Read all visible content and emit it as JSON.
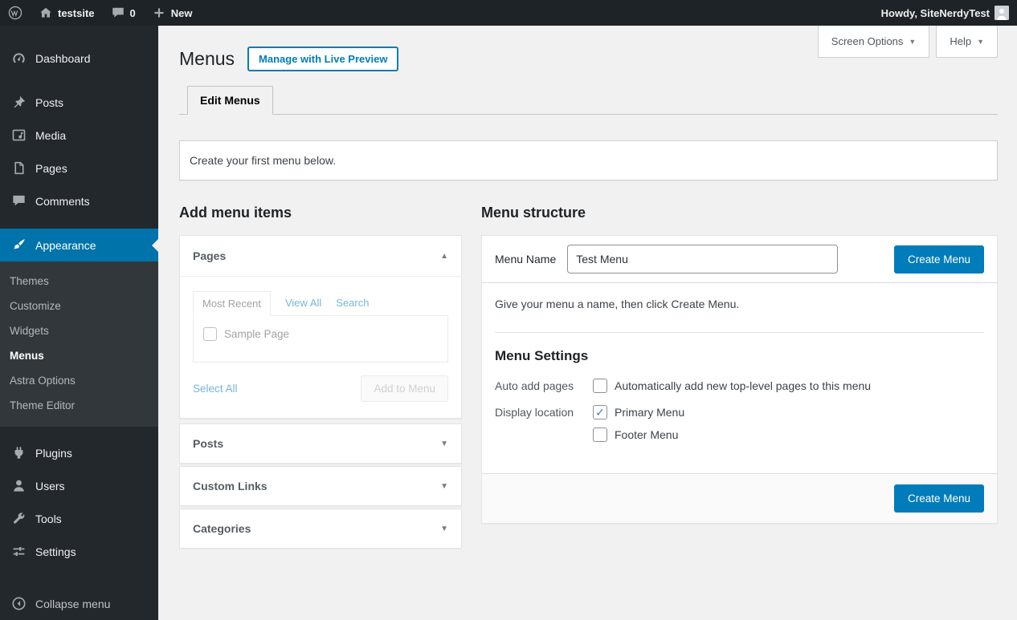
{
  "admin_bar": {
    "site_name": "testsite",
    "comment_count": "0",
    "new_label": "New",
    "howdy": "Howdy, SiteNerdyTest"
  },
  "sidebar": {
    "items": [
      {
        "label": "Dashboard"
      },
      {
        "label": "Posts"
      },
      {
        "label": "Media"
      },
      {
        "label": "Pages"
      },
      {
        "label": "Comments"
      },
      {
        "label": "Appearance"
      },
      {
        "label": "Plugins"
      },
      {
        "label": "Users"
      },
      {
        "label": "Tools"
      },
      {
        "label": "Settings"
      }
    ],
    "appearance_submenu": [
      {
        "label": "Themes"
      },
      {
        "label": "Customize"
      },
      {
        "label": "Widgets"
      },
      {
        "label": "Menus",
        "current": true
      },
      {
        "label": "Astra Options"
      },
      {
        "label": "Theme Editor"
      }
    ],
    "collapse_label": "Collapse menu"
  },
  "header": {
    "screen_options": "Screen Options",
    "help": "Help",
    "page_title": "Menus",
    "live_preview_button": "Manage with Live Preview",
    "tab_edit_menus": "Edit Menus",
    "notice": "Create your first menu below."
  },
  "add_menu_items": {
    "heading": "Add menu items",
    "pages": {
      "title": "Pages",
      "tabs": [
        {
          "label": "Most Recent",
          "active": true
        },
        {
          "label": "View All"
        },
        {
          "label": "Search"
        }
      ],
      "items": [
        {
          "label": "Sample Page",
          "checked": false
        }
      ],
      "select_all": "Select All",
      "add_to_menu": "Add to Menu",
      "disabled": true
    },
    "accordions": [
      {
        "title": "Posts"
      },
      {
        "title": "Custom Links"
      },
      {
        "title": "Categories"
      }
    ]
  },
  "menu_structure": {
    "heading": "Menu structure",
    "menu_name_label": "Menu Name",
    "menu_name_value": "Test Menu",
    "create_menu_button": "Create Menu",
    "hint": "Give your menu a name, then click Create Menu.",
    "settings_heading": "Menu Settings",
    "auto_add_label": "Auto add pages",
    "auto_add_text": "Automatically add new top-level pages to this menu",
    "auto_add_checked": false,
    "display_location_label": "Display location",
    "locations": [
      {
        "label": "Primary Menu",
        "checked": true
      },
      {
        "label": "Footer Menu",
        "checked": false
      }
    ],
    "footer_create_button": "Create Menu"
  },
  "icons": {
    "dropdown_arrow": "▼",
    "accordion_open_arrow": "▲",
    "accordion_closed_arrow": "▼",
    "check_glyph": "✓"
  },
  "colors": {
    "admin_bar_bg": "#1d2327",
    "sidebar_bg": "#23282d",
    "submenu_bg": "#32373c",
    "sidebar_active": "#0073aa",
    "primary_button": "#007cba",
    "content_bg": "#f1f1f1",
    "check_blue": "#3582c4"
  }
}
